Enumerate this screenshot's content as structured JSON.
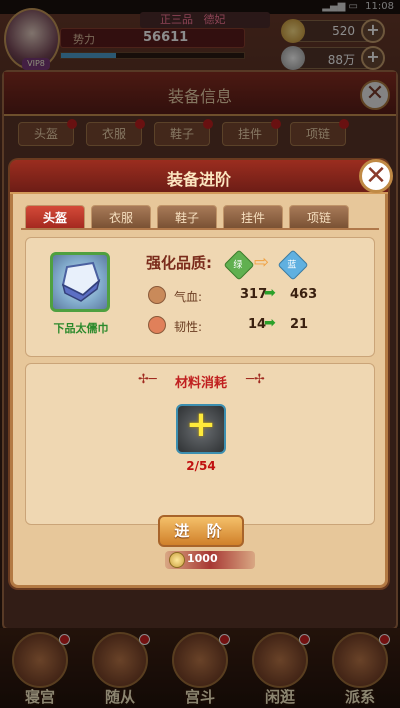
{
  "status_bar": {
    "time": "11:08"
  },
  "player": {
    "rank": "正三品",
    "rank_extra": "德妃",
    "power_label": "势力",
    "power": "56611",
    "vip": "VIP8"
  },
  "resources": {
    "ingot": "520",
    "silver": "88万"
  },
  "background_dialog": {
    "title": "装备信息",
    "tabs": [
      "头盔",
      "衣服",
      "鞋子",
      "挂件",
      "项链"
    ]
  },
  "dialog": {
    "title": "装备进阶",
    "tabs": [
      "头盔",
      "衣服",
      "鞋子",
      "挂件",
      "项链"
    ],
    "active_tab": "头盔",
    "item": {
      "name": "下品太儒巾",
      "quality_color": "#4fa040"
    },
    "quality": {
      "label": "强化品质:",
      "from": "绿",
      "to": "蓝"
    },
    "stats": [
      {
        "label": "气血:",
        "from": "317",
        "to": "463",
        "icon": "heart-icon"
      },
      {
        "label": "韧性:",
        "from": "14",
        "to": "21",
        "icon": "toughness-icon"
      }
    ],
    "materials": {
      "title": "材料消耗",
      "count": "2/54"
    },
    "advance_button": "进 阶",
    "cost": "1000"
  },
  "bottom_nav": [
    "寝宫",
    "随从",
    "宫斗",
    "闲逛",
    "派系"
  ]
}
